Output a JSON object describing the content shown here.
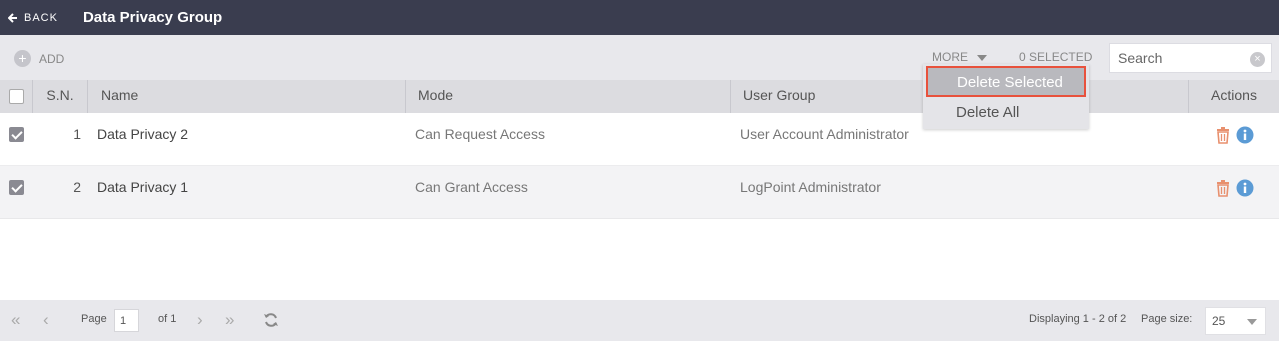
{
  "header": {
    "back_label": "BACK",
    "title": "Data Privacy Group"
  },
  "toolbar": {
    "add_label": "ADD",
    "more_label": "MORE",
    "selected_label": "0 SELECTED",
    "search_placeholder": "Search",
    "search_value": ""
  },
  "dropdown": {
    "items": [
      "Delete Selected",
      "Delete All"
    ],
    "highlighted": "Delete Selected"
  },
  "table": {
    "columns": [
      "S.N.",
      "Name",
      "Mode",
      "User Group",
      "Actions"
    ],
    "rows": [
      {
        "sn": "1",
        "name": "Data Privacy 2",
        "mode": "Can Request Access",
        "user_group": "User Account Administrator",
        "checked": true
      },
      {
        "sn": "2",
        "name": "Data Privacy 1",
        "mode": "Can Grant Access",
        "user_group": "LogPoint Administrator",
        "checked": true
      }
    ]
  },
  "pagination": {
    "page_label": "Page",
    "page_value": "1",
    "of_label": "of 1",
    "displaying": "Displaying 1 - 2 of 2",
    "page_size_label": "Page size:",
    "page_size": "25"
  },
  "colors": {
    "header_bg": "#3a3d4f",
    "delete_icon": "#e8906e",
    "info_icon": "#5b9bd5",
    "highlight_border": "#e8513c"
  }
}
